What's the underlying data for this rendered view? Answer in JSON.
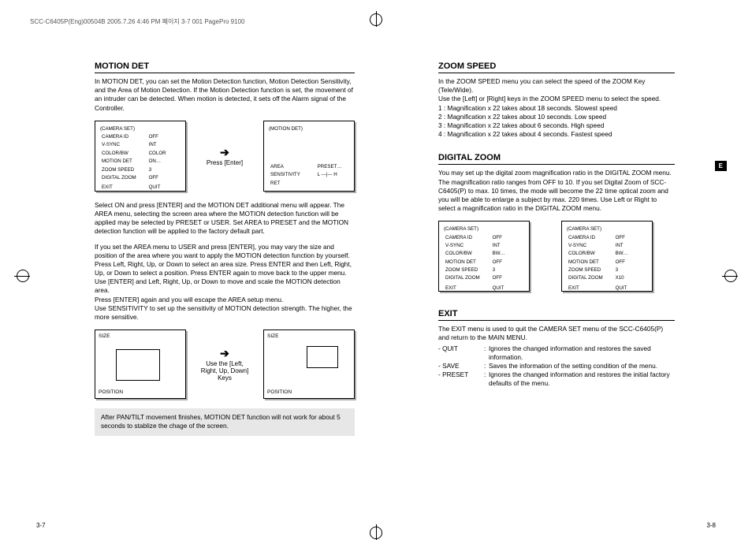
{
  "header": "SCC-C6405P(Eng)00504B  2005.7.26 4:46 PM  페이지 3-7   001 PagePro 9100",
  "page_left_num": "3-7",
  "page_right_num": "3-8",
  "tab_label": "E",
  "motion_det": {
    "title": "MOTION DET",
    "intro": "In MOTION DET, you can set the Motion Detection function, Motion Detection Sensitivity, and the Area of Motion Detection.  If the Motion Detection function is set, the movement of an intruder can be detected.  When motion is detected, it sets off the Alarm signal of the Controller.",
    "osd1_title": "(CAMERA SET)",
    "osd1_rows": [
      [
        "CAMERA ID",
        "OFF"
      ],
      [
        "V-SYNC",
        "INT"
      ],
      [
        "COLOR/BW",
        "COLOR"
      ],
      [
        "MOTION DET",
        "ON…"
      ],
      [
        "ZOOM SPEED",
        "3"
      ],
      [
        "DIGITAL ZOOM",
        "OFF"
      ],
      [
        "",
        ""
      ],
      [
        "EXIT",
        "QUIT"
      ]
    ],
    "arrow1_label": "Press [Enter]",
    "osd2_title": "(MOTION DET)",
    "osd2_rows": [
      [
        "AREA",
        "PRESET…"
      ],
      [
        "SENSITIVITY",
        "L ---|--- H"
      ],
      [
        "RET",
        ""
      ]
    ],
    "body1": "Select ON and press [ENTER] and the MOTION DET additional menu will appear. The AREA menu, selecting the screen area where the MOTION detection function will be applied may be selected by PRESET or USER. Set AREA to PRESET and the MOTION detection function will be applied to the factory default part.",
    "body2": "If you set the AREA menu to USER and press [ENTER], you may vary the size and position of the area where you want to apply the MOTION detection function by yourself. Press Left, Right, Up, or Down to select an area size. Press ENTER and then Left, Right, Up, or Down to select a position. Press ENTER again to move back to the upper menu.",
    "body3": "Use [ENTER] and Left, Right, Up, or Down  to move and scale the MOTION detection area.",
    "body4": "Press [ENTER] again and you will escape the AREA setup menu.",
    "body5": "Use SENSITIVITY to set up the sensitivity of MOTION detection strength. The higher, the more sensitive.",
    "size_label": "SIZE",
    "position_label": "POSITION",
    "arrow2_label": "Use the [Left, Right, Up, Down] Keys",
    "note": "After PAN/TILT movement finishes, MOTION DET function will not work for about 5 seconds to stablize the chage of the screen."
  },
  "zoom_speed": {
    "title": "ZOOM SPEED",
    "intro": "In the ZOOM SPEED menu you can select the speed of the ZOOM Key (Tele/Wide).",
    "line2": "Use the [Left] or [Right] keys in the ZOOM SPEED menu to select the speed.",
    "rows": [
      "1 : Magnification x 22 takes about 18 seconds.  Slowest speed",
      "2 : Magnification x 22 takes about 10 seconds.  Low speed",
      "3 : Magnification x 22 takes about 6 seconds.  High speed",
      "4 : Magnification x 22 takes about 4 seconds.  Fastest speed"
    ]
  },
  "digital_zoom": {
    "title": "DIGITAL ZOOM",
    "intro": "You may set up the digital zoom magnification ratio in the DIGITAL ZOOM menu. The magnification ratio ranges from OFF to 10. If you set Digital Zoom of SCC-C6405(P) to max. 10 times, the mode will become the 22 time optical zoom and you will be able to enlarge a subject by max. 220 times. Use Left or Right to select a magnification ratio in the DIGITAL ZOOM menu.",
    "osd1_title": "(CAMERA SET)",
    "osd1_rows": [
      [
        "CAMERA ID",
        "OFF"
      ],
      [
        "V-SYNC",
        "INT"
      ],
      [
        "COLOR/BW",
        "BW…"
      ],
      [
        "MOTION DET",
        "OFF"
      ],
      [
        "ZOOM SPEED",
        "3"
      ],
      [
        "DIGITAL ZOOM",
        "OFF"
      ],
      [
        "",
        ""
      ],
      [
        "EXIT",
        "QUIT"
      ]
    ],
    "osd2_title": "(CAMERA SET)",
    "osd2_rows": [
      [
        "CAMERA ID",
        "OFF"
      ],
      [
        "V-SYNC",
        "INT"
      ],
      [
        "COLOR/BW",
        "BW…"
      ],
      [
        "MOTION DET",
        "OFF"
      ],
      [
        "ZOOM SPEED",
        "3"
      ],
      [
        "DIGITAL ZOOM",
        "X10"
      ],
      [
        "",
        ""
      ],
      [
        "EXIT",
        "QUIT"
      ]
    ]
  },
  "exit": {
    "title": "EXIT",
    "intro": "The EXIT menu is used to quit the CAMERA SET menu of the SCC-C6405(P) and return to the MAIN MENU.",
    "rows": [
      {
        "k": "- QUIT",
        "v": "Ignores the changed information and restores the saved information."
      },
      {
        "k": "- SAVE",
        "v": "Saves the information of the setting condition of the menu."
      },
      {
        "k": "- PRESET",
        "v": "Ignores the changed information and restores the initial factory defaults of the menu."
      }
    ]
  }
}
